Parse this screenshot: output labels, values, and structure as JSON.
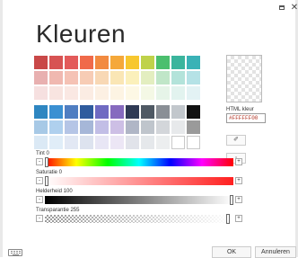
{
  "window": {
    "title": "Kleuren",
    "restore_icon": "restore-icon",
    "close_glyph": "✕"
  },
  "palette": {
    "rows": [
      [
        "#c94848",
        "#d75353",
        "#e35a5a",
        "#f06a4a",
        "#f28a40",
        "#f5a83a",
        "#f7c72f",
        "#bfd24a",
        "#4bbf6e",
        "#3bb59d",
        "#3ab2b6"
      ],
      [
        "#e8b0b0",
        "#f0b8b0",
        "#f5c2b5",
        "#f7ccb5",
        "#f8d8b5",
        "#fae6b5",
        "#fbf0bb",
        "#e3eec0",
        "#c0e6c8",
        "#b3e3da",
        "#b5e2e6"
      ],
      [
        "#f6e0e0",
        "#f8e4e0",
        "#fae8e3",
        "#fbece3",
        "#fcf0e3",
        "#fdf4e3",
        "#fdf8e5",
        "#f4f8e5",
        "#e6f4e8",
        "#e2f3ef",
        "#e3f2f4"
      ],
      [
        "#2e86c1",
        "#3a90d2",
        "#4f7ec2",
        "#2f5c9e",
        "#6f6ac2",
        "#866abf",
        "#2f3a55",
        "#4f5964",
        "#8a8f96",
        "#c2c7cc",
        "#111111"
      ],
      [
        "#a7c9e6",
        "#afd0ee",
        "#b5c5e6",
        "#a6b7d8",
        "#c2bee6",
        "#cdbfe5",
        "#b0b6c6",
        "#bfc5cc",
        "#d3d6da",
        "#e7e9eb",
        "#9a9a9a"
      ],
      [
        "#dbe9f5",
        "#e0edf8",
        "#e2e8f4",
        "#dde3ef",
        "#e8e6f5",
        "#ece6f5",
        "#e1e3ea",
        "#e5e8eb",
        "#eceeef",
        null,
        null
      ]
    ]
  },
  "color": {
    "html_label": "HTML kleur",
    "html_value": "#FFFFFF00",
    "picker_icon": "eyedropper-icon",
    "picker_glyph": "✐",
    "clear_icon": "no-color-icon",
    "clear_glyph": "▫"
  },
  "sliders": [
    {
      "label": "Tint 0",
      "minus": "-",
      "plus": "+",
      "level": 0
    },
    {
      "label": "Saturatie 0",
      "minus": "-",
      "plus": "+",
      "level": 0
    },
    {
      "label": "Helderheid 100",
      "minus": "-",
      "plus": "+",
      "level": 1
    },
    {
      "label": "Transparantie 255",
      "minus": "-",
      "plus": "+",
      "level": 0.97
    }
  ],
  "buttons": {
    "ok": "OK",
    "cancel": "Annuleren"
  },
  "taskbar": {
    "keyboard_icon": "keyboard-icon"
  }
}
